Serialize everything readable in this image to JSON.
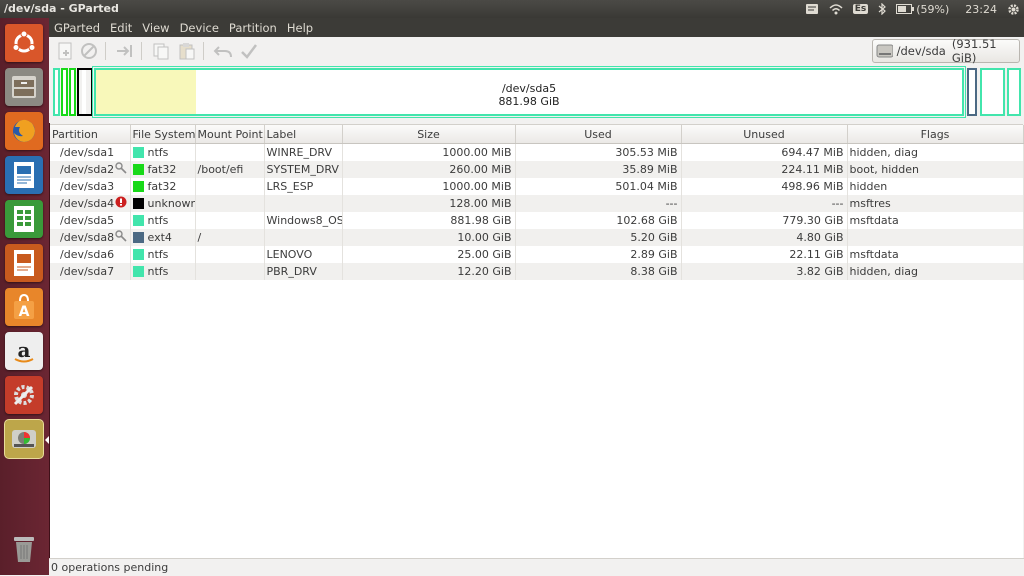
{
  "window": {
    "title": "/dev/sda - GParted"
  },
  "tray": {
    "keyboard": "Es",
    "battery": "(59%)",
    "clock": "23:24"
  },
  "menubar": {
    "items": [
      "GParted",
      "Edit",
      "View",
      "Device",
      "Partition",
      "Help"
    ]
  },
  "toolbar": {
    "device_selector": {
      "device": "/dev/sda",
      "size": "(931.51 GiB)"
    }
  },
  "graph": {
    "selected_label": "/dev/sda5",
    "selected_size": "881.98 GiB",
    "colors": {
      "ntfs": "#42e5ac",
      "fat32": "#18d918",
      "unknown": "#000000",
      "ext4": "#4b6983",
      "used": "#f8f8ba"
    },
    "selected_used_fraction": 0.116
  },
  "table": {
    "columns": [
      "Partition",
      "File System",
      "Mount Point",
      "Label",
      "Size",
      "Used",
      "Unused",
      "Flags"
    ],
    "rows": [
      {
        "partition": "/dev/sda1",
        "status_icon": "",
        "fs": "ntfs",
        "fs_color": "#42e5ac",
        "mount": "",
        "label": "WINRE_DRV",
        "size": "1000.00 MiB",
        "used": "305.53 MiB",
        "unused": "694.47 MiB",
        "flags": "hidden, diag"
      },
      {
        "partition": "/dev/sda2",
        "status_icon": "key-icon",
        "fs": "fat32",
        "fs_color": "#18d918",
        "mount": "/boot/efi",
        "label": "SYSTEM_DRV",
        "size": "260.00 MiB",
        "used": "35.89 MiB",
        "unused": "224.11 MiB",
        "flags": "boot, hidden"
      },
      {
        "partition": "/dev/sda3",
        "status_icon": "",
        "fs": "fat32",
        "fs_color": "#18d918",
        "mount": "",
        "label": "LRS_ESP",
        "size": "1000.00 MiB",
        "used": "501.04 MiB",
        "unused": "498.96 MiB",
        "flags": "hidden"
      },
      {
        "partition": "/dev/sda4",
        "status_icon": "error-icon",
        "fs": "unknown",
        "fs_color": "#000000",
        "mount": "",
        "label": "",
        "size": "128.00 MiB",
        "used": "---",
        "unused": "---",
        "flags": "msftres"
      },
      {
        "partition": "/dev/sda5",
        "status_icon": "",
        "fs": "ntfs",
        "fs_color": "#42e5ac",
        "mount": "",
        "label": "Windows8_OS",
        "size": "881.98 GiB",
        "used": "102.68 GiB",
        "unused": "779.30 GiB",
        "flags": "msftdata"
      },
      {
        "partition": "/dev/sda8",
        "status_icon": "key-icon",
        "fs": "ext4",
        "fs_color": "#4b6983",
        "mount": "/",
        "label": "",
        "size": "10.00 GiB",
        "used": "5.20 GiB",
        "unused": "4.80 GiB",
        "flags": ""
      },
      {
        "partition": "/dev/sda6",
        "status_icon": "",
        "fs": "ntfs",
        "fs_color": "#42e5ac",
        "mount": "",
        "label": "LENOVO",
        "size": "25.00 GiB",
        "used": "2.89 GiB",
        "unused": "22.11 GiB",
        "flags": "msftdata"
      },
      {
        "partition": "/dev/sda7",
        "status_icon": "",
        "fs": "ntfs",
        "fs_color": "#42e5ac",
        "mount": "",
        "label": "PBR_DRV",
        "size": "12.20 GiB",
        "used": "8.38 GiB",
        "unused": "3.82 GiB",
        "flags": "hidden, diag"
      }
    ]
  },
  "status": {
    "text": "0 operations pending"
  }
}
